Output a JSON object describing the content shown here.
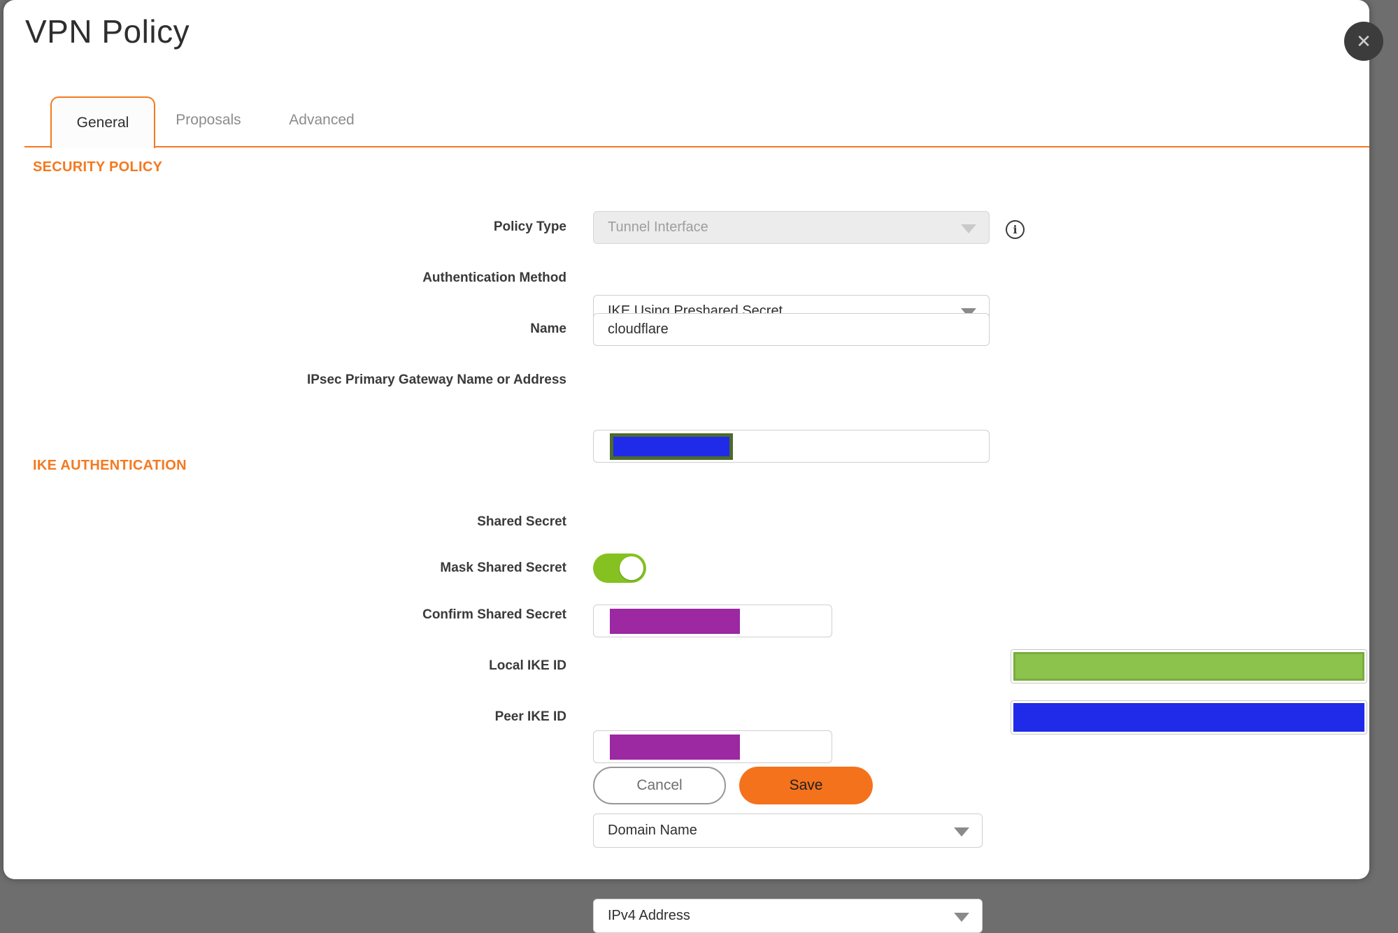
{
  "dialog": {
    "title": "VPN Policy",
    "close_glyph": "✕"
  },
  "tabs": [
    {
      "label": "General",
      "active": true
    },
    {
      "label": "Proposals",
      "active": false
    },
    {
      "label": "Advanced",
      "active": false
    }
  ],
  "sections": {
    "security_policy": "SECURITY POLICY",
    "ike_authentication": "IKE AUTHENTICATION"
  },
  "fields": {
    "policy_type": {
      "label": "Policy Type",
      "value": "Tunnel Interface",
      "disabled": true,
      "info_glyph": "i"
    },
    "authentication_method": {
      "label": "Authentication Method",
      "value": "IKE Using Preshared Secret"
    },
    "name": {
      "label": "Name",
      "value": "cloudflare"
    },
    "ipsec_gateway": {
      "label": "IPsec Primary Gateway Name or Address",
      "value_state": "redacted"
    },
    "shared_secret": {
      "label": "Shared Secret",
      "value_state": "redacted"
    },
    "mask_shared_secret": {
      "label": "Mask Shared Secret",
      "state": "on"
    },
    "confirm_shared_secret": {
      "label": "Confirm Shared Secret",
      "value_state": "redacted"
    },
    "local_ike_id": {
      "label": "Local IKE ID",
      "type_value": "Domain Name",
      "value_state": "redacted"
    },
    "peer_ike_id": {
      "label": "Peer IKE ID",
      "type_value": "IPv4 Address",
      "value_state": "redacted"
    }
  },
  "buttons": {
    "cancel": "Cancel",
    "save": "Save"
  },
  "colors": {
    "accent_orange": "#F4791F",
    "save_orange": "#F4721C",
    "toggle_green": "#85C221",
    "redact_purple": "#9C28A2",
    "redact_blue": "#1F2BE8",
    "redact_green": "#8CC34D",
    "redact_olive_border": "#4D6B2B",
    "backdrop_gray": "#6E6E6E"
  }
}
